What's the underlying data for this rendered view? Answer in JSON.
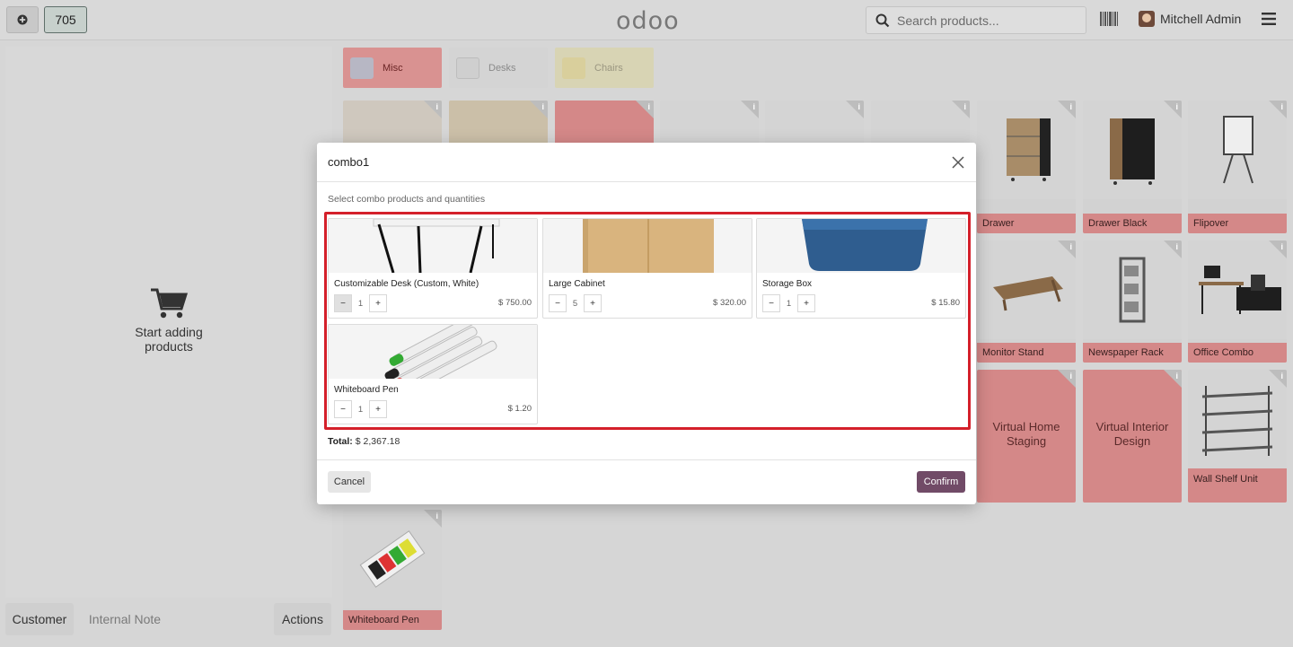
{
  "topbar": {
    "order_number": "705",
    "logo": "odoo",
    "search_placeholder": "Search products...",
    "user_name": "Mitchell Admin"
  },
  "cart": {
    "empty_message": "Start adding products"
  },
  "bottom_bar": {
    "customer": "Customer",
    "internal_note": "Internal Note",
    "actions": "Actions"
  },
  "categories": [
    {
      "label": "Misc"
    },
    {
      "label": "Desks"
    },
    {
      "label": "Chairs"
    }
  ],
  "products": {
    "drawer": "Drawer",
    "drawer_black": "Drawer Black",
    "flipover": "Flipover",
    "monitor_stand": "Monitor Stand",
    "newspaper_rack": "Newspaper Rack",
    "office_combo": "Office Combo",
    "virtual_home_staging": "Virtual Home Staging",
    "virtual_interior_design": "Virtual Interior Design",
    "wall_shelf_unit": "Wall Shelf Unit",
    "whiteboard_pen": "Whiteboard Pen",
    "info_glyph": "i"
  },
  "dialog": {
    "title": "combo1",
    "subtitle": "Select combo products and quantities",
    "total_label": "Total:",
    "total_value": "$ 2,367.18",
    "cancel": "Cancel",
    "confirm": "Confirm",
    "items": [
      {
        "name": "Customizable Desk (Custom, White)",
        "qty": "1",
        "price": "$ 750.00"
      },
      {
        "name": "Large Cabinet",
        "qty": "5",
        "price": "$ 320.00"
      },
      {
        "name": "Storage Box",
        "qty": "1",
        "price": "$ 15.80"
      },
      {
        "name": "Whiteboard Pen",
        "qty": "1",
        "price": "$ 1.20"
      }
    ],
    "minus": "−",
    "plus": "+"
  },
  "colors": {
    "accent": "#714b67",
    "highlight_border": "#d4202a",
    "tile_label": "#d48888"
  }
}
